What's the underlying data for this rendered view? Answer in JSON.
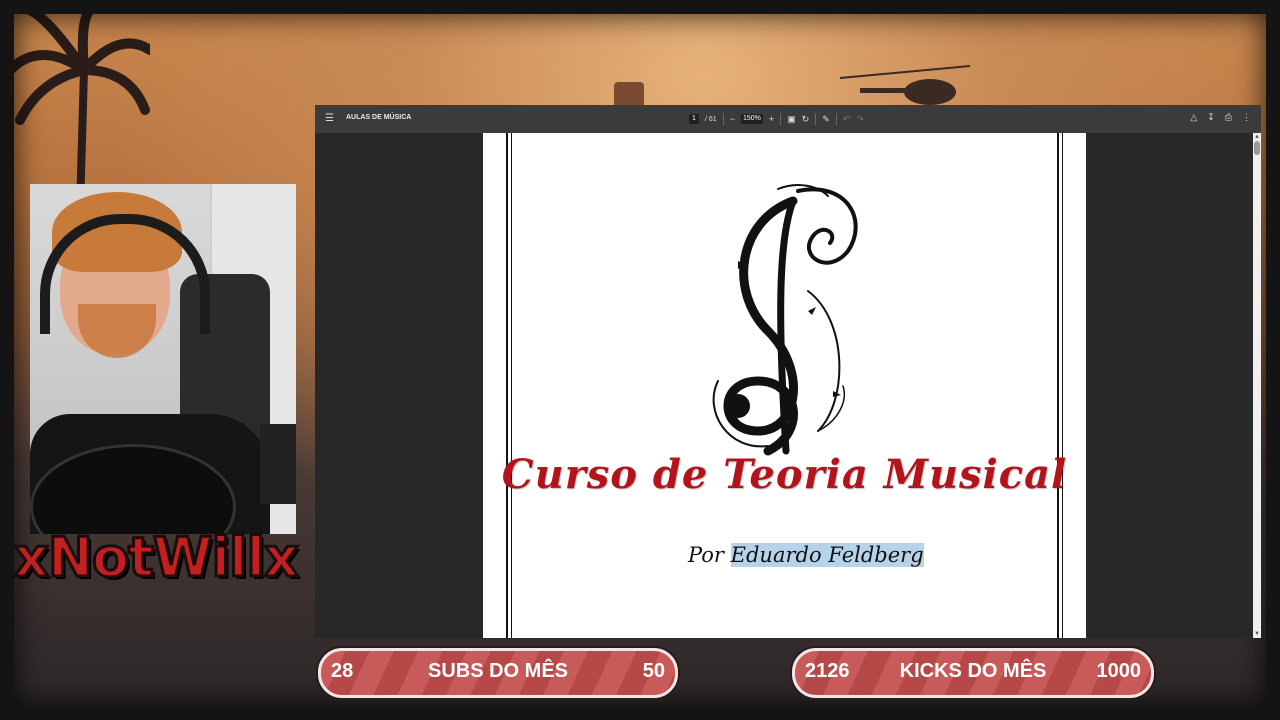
{
  "streamer": {
    "name": "xNotWillx"
  },
  "pdf_viewer": {
    "title": "AULAS DE MÚSICA",
    "current_page": "1",
    "total_pages": "/ 61",
    "zoom": "150%",
    "icons": {
      "menu": "menu-icon",
      "zoom_out": "minus-icon",
      "zoom_in": "plus-icon",
      "fit": "fit-page-icon",
      "rotate": "rotate-icon",
      "annotate": "annotate-icon",
      "undo": "undo-icon",
      "redo": "redo-icon",
      "drive": "drive-icon",
      "download": "download-icon",
      "print": "print-icon",
      "more": "more-vertical-icon"
    },
    "document": {
      "title": "Curso de Teoria Musical",
      "author_prefix": "Por",
      "author_name": "Eduardo Feldberg"
    }
  },
  "goals": [
    {
      "current": "28",
      "label": "SUBS DO MÊS",
      "target": "50"
    },
    {
      "current": "2126",
      "label": "KICKS DO MÊS",
      "target": "1000"
    }
  ],
  "colors": {
    "accent_red": "#c41f1f",
    "title_red": "#b3141c",
    "goal_bar": "#c95a5a",
    "selection": "#b7d3ea"
  }
}
